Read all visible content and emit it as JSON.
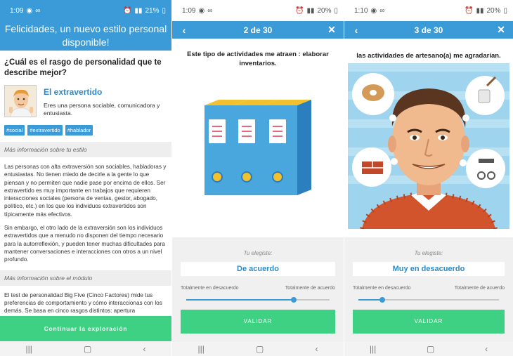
{
  "screen1": {
    "status": {
      "time": "1:09",
      "battery": "21%"
    },
    "banner": "Felicidades, un nuevo estilo personal disponible!",
    "question": "¿Cuál es el rasgo de personalidad que te describe mejor?",
    "profile": {
      "name": "El extravertido",
      "description": "Eres una persona sociable, comunicadora y entusiasta."
    },
    "tags": [
      "#social",
      "#extravertido",
      "#hablador"
    ],
    "section1_title": "Más información sobre tu estilo",
    "para1": "Las personas con alta extraversión son sociables, habladoras y entusiastas. No tienen miedo de decirle a la gente lo que piensan y no permiten que nadie pase por encima de ellos. Ser extravertido es muy importante en trabajos que requieren interacciones sociales (persona de ventas, gestor, abogado, político, etc.) en los que los individuos extravertidos son típicamente más efectivos.",
    "para2": "Sin embargo, el otro lado de la extraversión son los individuos extravertidos que a menudo no disponen del tiempo necesario para la autorreflexión, y pueden tener muchas dificultades para mantener conversaciones e interacciones con otros a un nivel profundo.",
    "section2_title": "Más información sobre el módulo",
    "para3": "El test de personalidad Big Five (Cinco Factores) mide tus preferencias de comportamiento y cómo interaccionas con los demás. Se basa en cinco rasgos distintos: apertura",
    "cta": "Continuar la exploración"
  },
  "screen2": {
    "status": {
      "time": "1:09",
      "battery": "20%"
    },
    "title": "2 de 30",
    "question": "Este tipo de actividades me atraen : elaborar inventarios.",
    "chosen_label": "Tu elegiste:",
    "chosen_value": "De acuerdo",
    "scale_min": "Totalmente en desacuerdo",
    "scale_max": "Totalmente de acuerdo",
    "slider_value": 0.75,
    "validate": "VALIDAR"
  },
  "screen3": {
    "status": {
      "time": "1:10",
      "battery": "20%"
    },
    "title": "3 de 30",
    "question": "las actividades de artesano(a) me agradarían.",
    "chosen_label": "Tu elegiste:",
    "chosen_value": "Muy en desacuerdo",
    "scale_min": "Totalmente en desacuerdo",
    "scale_max": "Totalmente de acuerdo",
    "slider_value": 0.17,
    "validate": "VALIDAR"
  },
  "icons": {
    "back": "back-arrow-icon",
    "close": "close-icon",
    "nav_recents": "recents-icon",
    "nav_home": "home-icon",
    "nav_back": "nav-back-icon"
  },
  "colors": {
    "primary": "#3a9bd8",
    "accent_green": "#3ed183",
    "link_blue": "#2c8bc9"
  }
}
